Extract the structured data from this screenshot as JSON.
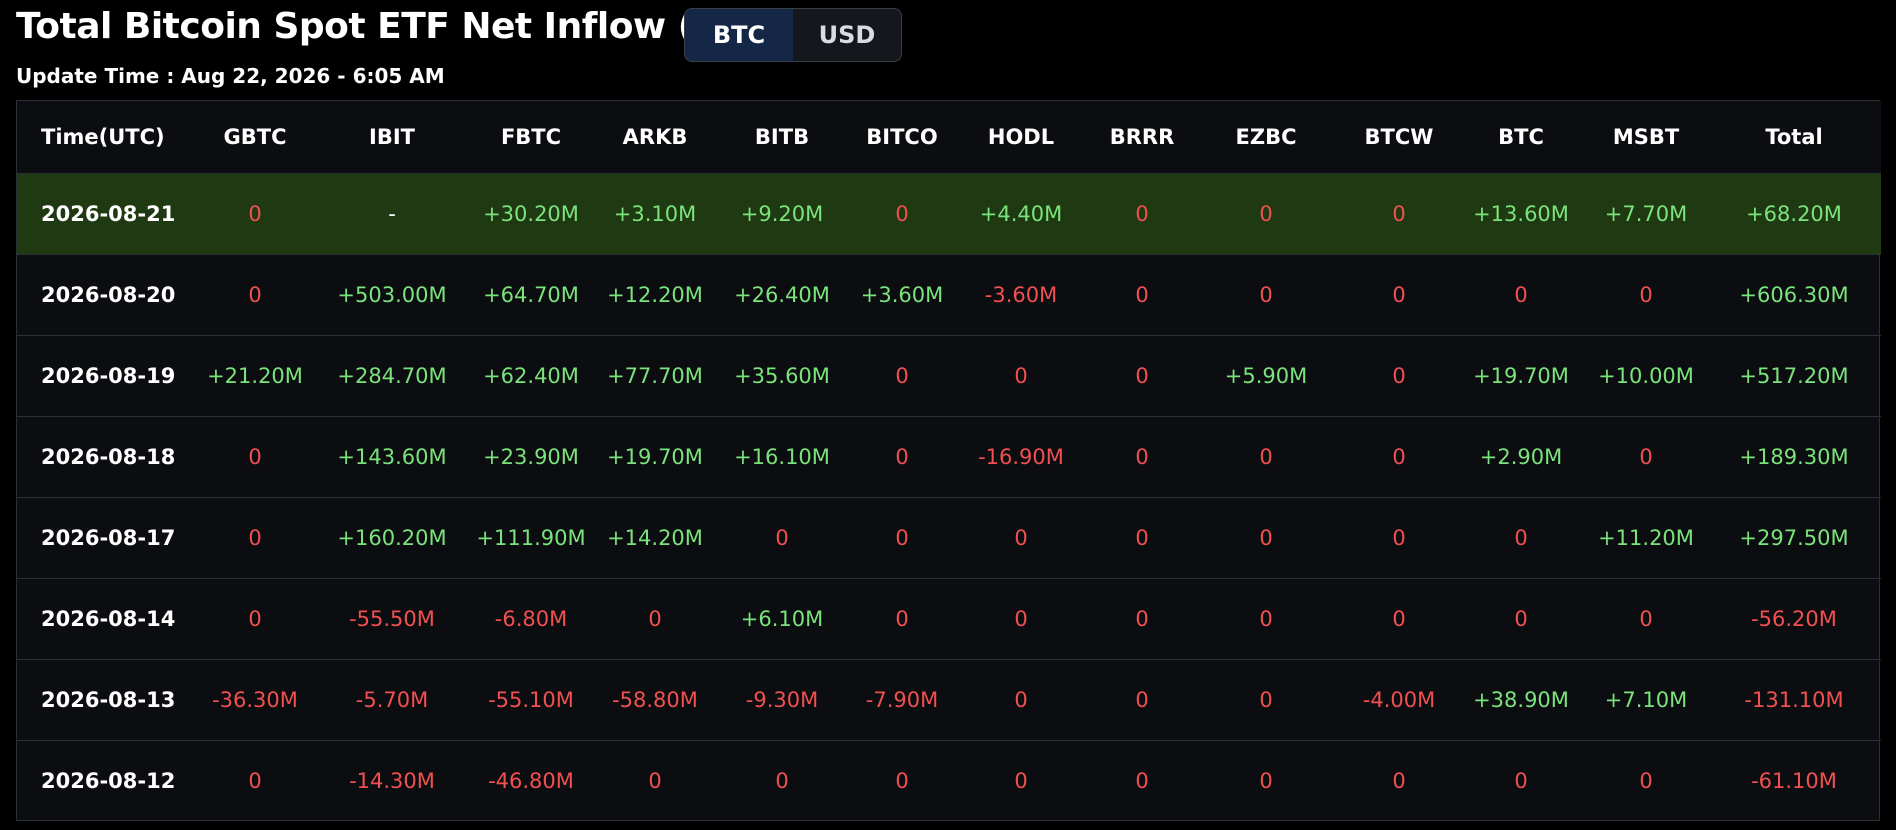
{
  "header": {
    "title": "Total Bitcoin Spot ETF Net Inflow (USD)",
    "update_time": "Update Time : Aug 22, 2026 - 6:05 AM"
  },
  "toggle": {
    "options": [
      "BTC",
      "USD"
    ],
    "active": "BTC"
  },
  "colors": {
    "positive": "#7be37b",
    "negative": "#f0504f",
    "highlight_row": "#1f3a12",
    "active_toggle": "#152746"
  },
  "table": {
    "columns": [
      "Time(UTC)",
      "GBTC",
      "IBIT",
      "FBTC",
      "ARKB",
      "BITB",
      "BITCO",
      "HODL",
      "BRRR",
      "EZBC",
      "BTCW",
      "BTC",
      "MSBT",
      "Total"
    ],
    "highlighted_row": 0,
    "rows": [
      [
        "2026-08-21",
        "0",
        "-",
        "+30.20M",
        "+3.10M",
        "+9.20M",
        "0",
        "+4.40M",
        "0",
        "0",
        "0",
        "+13.60M",
        "+7.70M",
        "+68.20M"
      ],
      [
        "2026-08-20",
        "0",
        "+503.00M",
        "+64.70M",
        "+12.20M",
        "+26.40M",
        "+3.60M",
        "-3.60M",
        "0",
        "0",
        "0",
        "0",
        "0",
        "+606.30M"
      ],
      [
        "2026-08-19",
        "+21.20M",
        "+284.70M",
        "+62.40M",
        "+77.70M",
        "+35.60M",
        "0",
        "0",
        "0",
        "+5.90M",
        "0",
        "+19.70M",
        "+10.00M",
        "+517.20M"
      ],
      [
        "2026-08-18",
        "0",
        "+143.60M",
        "+23.90M",
        "+19.70M",
        "+16.10M",
        "0",
        "-16.90M",
        "0",
        "0",
        "0",
        "+2.90M",
        "0",
        "+189.30M"
      ],
      [
        "2026-08-17",
        "0",
        "+160.20M",
        "+111.90M",
        "+14.20M",
        "0",
        "0",
        "0",
        "0",
        "0",
        "0",
        "0",
        "+11.20M",
        "+297.50M"
      ],
      [
        "2026-08-14",
        "0",
        "-55.50M",
        "-6.80M",
        "0",
        "+6.10M",
        "0",
        "0",
        "0",
        "0",
        "0",
        "0",
        "0",
        "-56.20M"
      ],
      [
        "2026-08-13",
        "-36.30M",
        "-5.70M",
        "-55.10M",
        "-58.80M",
        "-9.30M",
        "-7.90M",
        "0",
        "0",
        "0",
        "-4.00M",
        "+38.90M",
        "+7.10M",
        "-131.10M"
      ],
      [
        "2026-08-12",
        "0",
        "-14.30M",
        "-46.80M",
        "0",
        "0",
        "0",
        "0",
        "0",
        "0",
        "0",
        "0",
        "0",
        "-61.10M"
      ]
    ]
  }
}
